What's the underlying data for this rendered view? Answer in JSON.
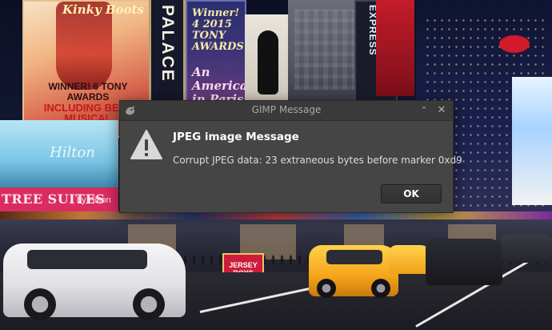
{
  "dialog": {
    "window_title": "GIMP Message",
    "heading": "JPEG image Message",
    "message": "Corrupt JPEG data: 23 extraneous bytes before marker 0xd9",
    "ok_label": "OK",
    "minimize_glyph": "⌃",
    "close_glyph": "✕",
    "icon": "warning-icon",
    "app_icon": "gimp-wilber-icon"
  },
  "background": {
    "kinky_title": "Kinky Boots",
    "kinky_caption_1": "WINNER! 6 TONY AWARDS",
    "kinky_caption_2": "INCLUDING BEST MUSICAL",
    "palace_sign": "PALACE",
    "american_top": "Winner! 4 2015 TONY AWARDS",
    "american_bottom": "An American in Paris",
    "express_sign": "EXPRESS",
    "hilton_sign": "Hilton",
    "tree_suites_sign": "TREE SUITES",
    "tree_suites_sub": "by Hilton",
    "jersey_sign": "JERSEY BOYS",
    "colors": {
      "dialog_bg": "#454545",
      "titlebar_bg": "#3a3a3a",
      "taxi": "#f6a51a",
      "tree_suites_pink": "#d92d61"
    }
  }
}
